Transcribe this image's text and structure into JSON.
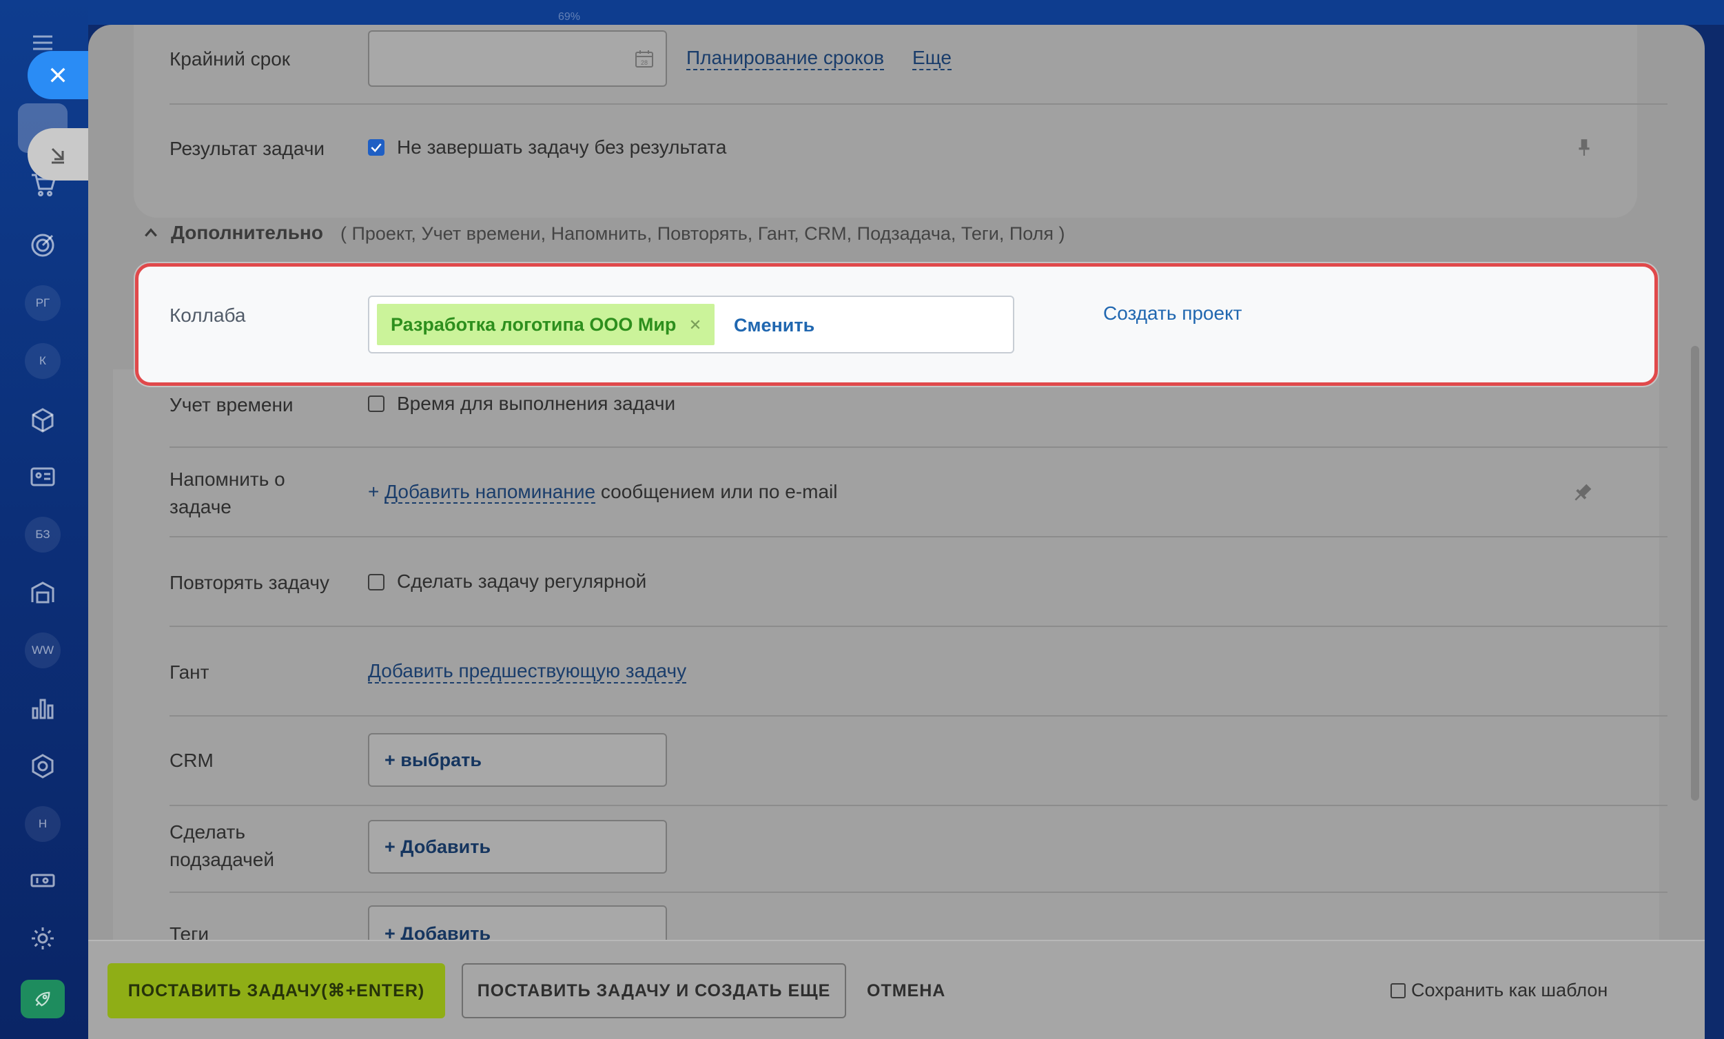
{
  "top_indicator": "69%",
  "sidebar": {
    "items": [
      {
        "icon": "hamburger-icon"
      },
      {
        "icon": "check-icon"
      },
      {
        "icon": "cart-icon"
      },
      {
        "icon": "target-icon"
      },
      {
        "badge": "РГ"
      },
      {
        "badge": "К"
      },
      {
        "icon": "cube-icon"
      },
      {
        "icon": "contact-card-icon"
      },
      {
        "badge": "БЗ"
      },
      {
        "icon": "warehouse-icon"
      },
      {
        "badge": "WW"
      },
      {
        "icon": "chart-icon"
      },
      {
        "icon": "hexagon-icon"
      },
      {
        "badge": "Н"
      },
      {
        "icon": "devices-icon"
      },
      {
        "icon": "gear-icon"
      },
      {
        "icon": "rocket-icon"
      }
    ]
  },
  "form": {
    "deadline": {
      "label": "Крайний срок",
      "value": "",
      "plan_link": "Планирование сроков",
      "more_link": "Еще"
    },
    "result": {
      "label": "Результат задачи",
      "checkbox_label": "Не завершать задачу без результата",
      "checked": true
    },
    "additional": {
      "title": "Дополнительно",
      "items": "( Проект,  Учет времени,  Напомнить,  Повторять,  Гант,  CRM,  Подзадача,  Теги,  Поля )"
    },
    "project": {
      "label": "Коллаба",
      "tag": "Разработка логотипа ООО Мир",
      "change_link": "Сменить",
      "create_link": "Создать проект"
    },
    "time_tracking": {
      "label": "Учет времени",
      "checkbox_label": "Время для выполнения задачи",
      "checked": false
    },
    "reminder": {
      "label_line1": "Напомнить о",
      "label_line2": "задаче",
      "plus": "+",
      "add_link": "Добавить напоминание",
      "suffix": "сообщением или по e-mail"
    },
    "repeat": {
      "label": "Повторять задачу",
      "checkbox_label": "Сделать задачу регулярной",
      "checked": false
    },
    "gantt": {
      "label": "Гант",
      "add_link": "Добавить предшествующую задачу"
    },
    "crm": {
      "label": "CRM",
      "button": "+  выбрать"
    },
    "subtask": {
      "label_line1": "Сделать",
      "label_line2": "подзадачей",
      "button": "+ Добавить"
    },
    "tags": {
      "label": "Теги",
      "button": "+ Добавить"
    }
  },
  "footer": {
    "submit": "ПОСТАВИТЬ ЗАДАЧУ(⌘+ENTER)",
    "submit_more": "ПОСТАВИТЬ ЗАДАЧУ И СОЗДАТЬ ЕЩЕ",
    "cancel": "ОТМЕНА",
    "save_template": "Сохранить как шаблон"
  }
}
